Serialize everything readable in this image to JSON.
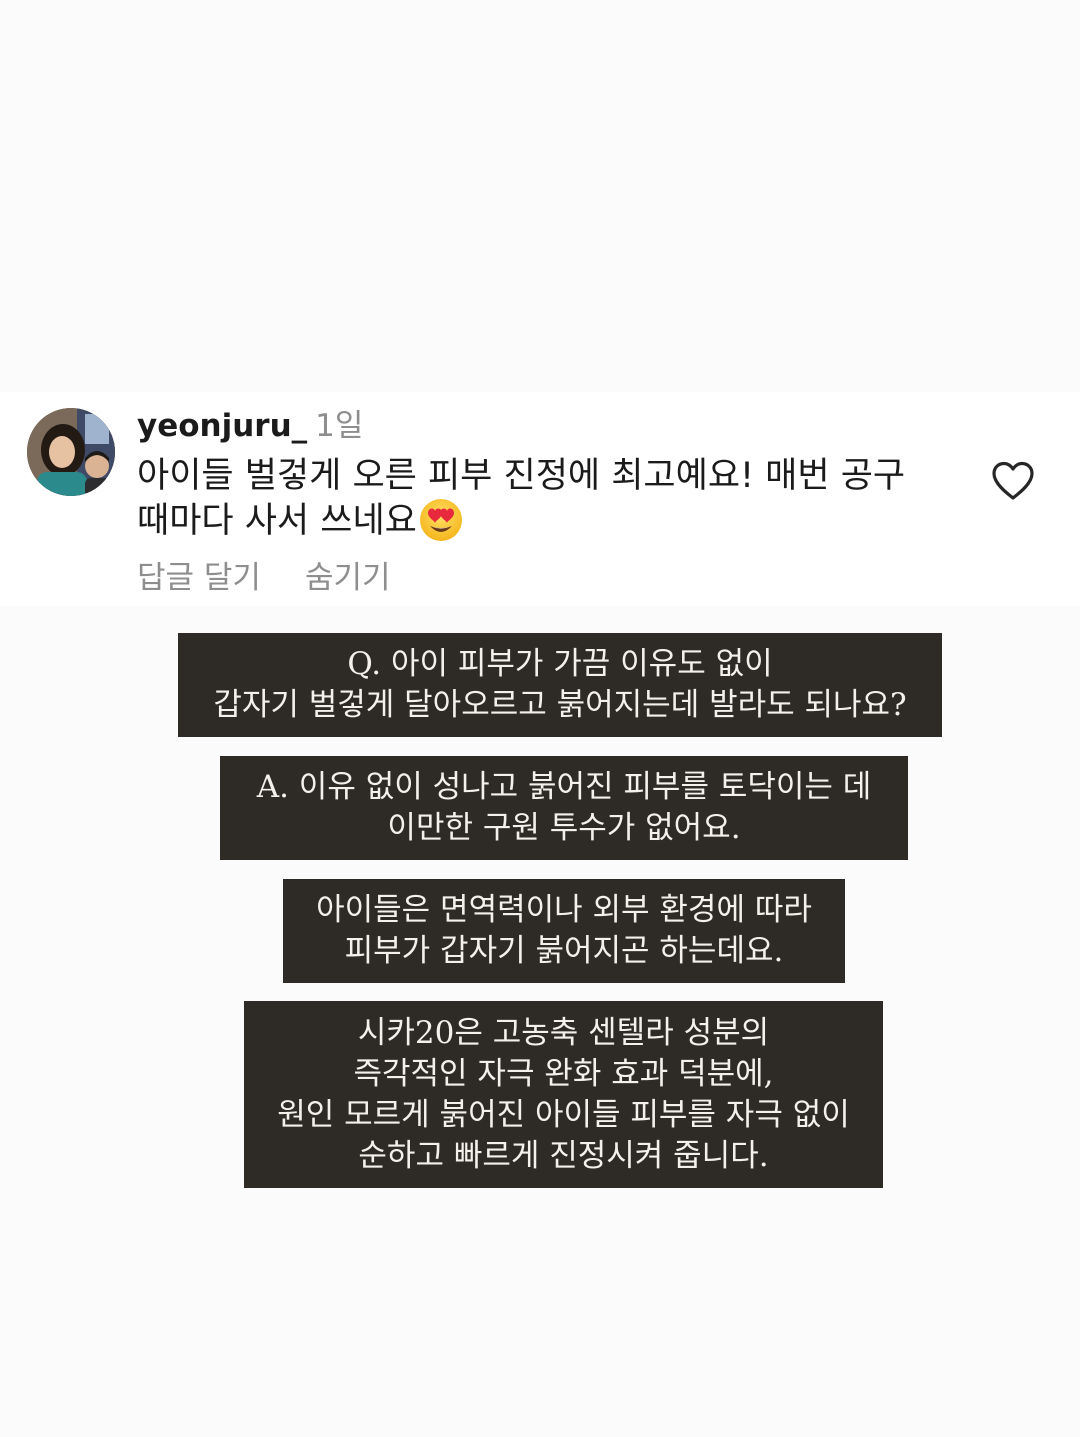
{
  "comment": {
    "username": "yeonjuru_",
    "time": "1일",
    "text": "아이들 벌겋게 오른 피부 진정에 최고예요! 매번 공구 때마다 사서 쓰네요",
    "emoji": "heart-eyes-emoji",
    "reply_label": "답글 달기",
    "hide_label": "숨기기",
    "like_icon": "heart-outline-icon"
  },
  "captions": [
    {
      "lines": [
        "Q. 아이 피부가 가끔 이유도 없이",
        "갑자기 벌겋게 달아오르고 붉어지는데 발라도 되나요?"
      ]
    },
    {
      "lines": [
        "A. 이유 없이 성나고 붉어진 피부를 토닥이는 데",
        "이만한 구원 투수가 없어요."
      ]
    },
    {
      "lines": [
        "아이들은 면역력이나 외부 환경에 따라",
        "피부가 갑자기 붉어지곤 하는데요."
      ]
    },
    {
      "lines": [
        "시카20은 고농축 센텔라 성분의",
        "즉각적인 자극 완화 효과 덕분에,",
        "원인 모르게 붉어진 아이들 피부를 자극 없이",
        "순하고 빠르게 진정시켜 줍니다."
      ]
    }
  ],
  "colors": {
    "caption_bg": "#2e2a26",
    "caption_text": "#f4f1ec",
    "muted_text": "#8e8e8e",
    "page_bg": "#fbfbfb"
  }
}
